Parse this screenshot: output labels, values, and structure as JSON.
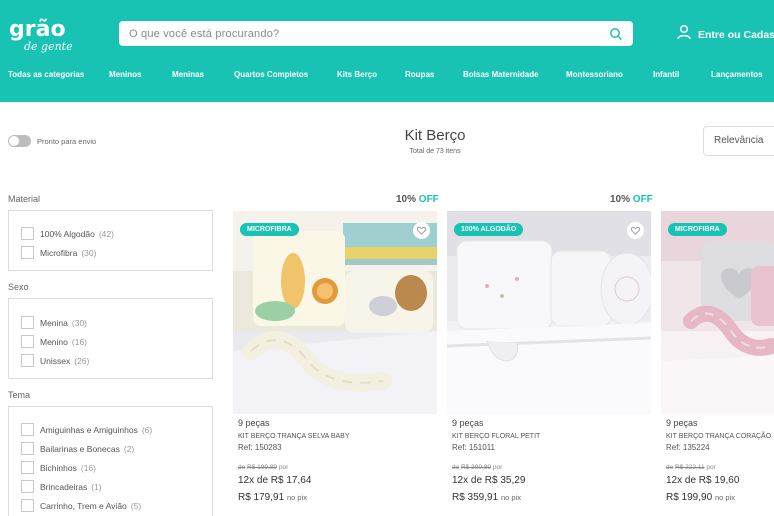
{
  "header": {
    "search_placeholder": "O que você está procurando?",
    "login_label": "Entre ou Cadastre"
  },
  "nav": [
    "Todas as categorias",
    "Meninos",
    "Meninas",
    "Quartos Completos",
    "Kits Berço",
    "Roupas",
    "Bolsas Maternidade",
    "Montessoriano",
    "Infantil",
    "Lançamentos"
  ],
  "toolbar": {
    "ready_label": "Pronto para envio",
    "title": "Kit Berço",
    "total": "Total de 73 itens",
    "sort_label": "Relevância"
  },
  "filters": [
    {
      "title": "Material",
      "options": [
        {
          "label": "100% Algodão",
          "count": "(42)"
        },
        {
          "label": "Microfibra",
          "count": "(30)"
        }
      ]
    },
    {
      "title": "Sexo",
      "options": [
        {
          "label": "Menina",
          "count": "(30)"
        },
        {
          "label": "Menino",
          "count": "(16)"
        },
        {
          "label": "Unissex",
          "count": "(26)"
        }
      ]
    },
    {
      "title": "Tema",
      "options": [
        {
          "label": "Amiguinhas e Amiguinhos",
          "count": "(6)"
        },
        {
          "label": "Bailarinas e Bonecas",
          "count": "(2)"
        },
        {
          "label": "Bichinhos",
          "count": "(16)"
        },
        {
          "label": "Brincadeiras",
          "count": "(1)"
        },
        {
          "label": "Carrinho, Trem e Avião",
          "count": "(5)"
        }
      ]
    }
  ],
  "products": [
    {
      "discount": "10%",
      "off": "OFF",
      "badge": "MICROFIBRA",
      "pieces": "9 peças",
      "name": "KIT BERÇO TRANÇA SELVA BABY",
      "ref": "Ref: 150283",
      "old_prefix": "de",
      "old_price": "R$ 199,89",
      "old_suffix": "por",
      "installment": "12x de R$ 17,64",
      "pix_price": "R$ 179,91",
      "pix_label": "no pix"
    },
    {
      "discount": "10%",
      "off": "OFF",
      "badge": "100% ALGODÃO",
      "pieces": "9 peças",
      "name": "KIT BERÇO FLORAL PETIT",
      "ref": "Ref: 151011",
      "old_prefix": "de",
      "old_price": "R$ 399,89",
      "old_suffix": "por",
      "installment": "12x de R$ 35,29",
      "pix_price": "R$ 359,91",
      "pix_label": "no pix"
    },
    {
      "discount": "",
      "off": "",
      "badge": "MICROFIBRA",
      "pieces": "9 peças",
      "name": "KIT BERÇO TRANÇA CORAÇÃO",
      "ref": "Ref: 135224",
      "old_prefix": "de",
      "old_price": "R$ 222,11",
      "old_suffix": "por",
      "installment": "12x de R$ 19,60",
      "pix_price": "R$ 199,90",
      "pix_label": "no pix"
    }
  ]
}
